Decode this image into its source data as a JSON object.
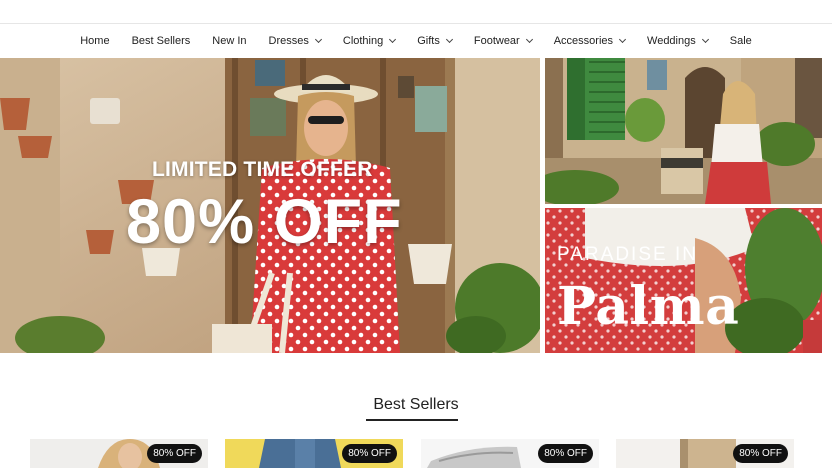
{
  "nav": {
    "items": [
      {
        "label": "Home",
        "dropdown": false
      },
      {
        "label": "Best Sellers",
        "dropdown": false
      },
      {
        "label": "New In",
        "dropdown": false
      },
      {
        "label": "Dresses",
        "dropdown": true
      },
      {
        "label": "Clothing",
        "dropdown": true
      },
      {
        "label": "Gifts",
        "dropdown": true
      },
      {
        "label": "Footwear",
        "dropdown": true
      },
      {
        "label": "Accessories",
        "dropdown": true
      },
      {
        "label": "Weddings",
        "dropdown": true
      },
      {
        "label": "Sale",
        "dropdown": false
      }
    ]
  },
  "hero": {
    "line1": "LIMITED TIME OFFER",
    "line2": "80% OFF"
  },
  "promo_bottom": {
    "line1": "PARADISE IN",
    "line2": "Palma"
  },
  "best_sellers": {
    "title": "Best Sellers",
    "products": [
      {
        "badge": "80% OFF"
      },
      {
        "badge": "80% OFF"
      },
      {
        "badge": "80% OFF"
      },
      {
        "badge": "80% OFF"
      }
    ]
  },
  "colors": {
    "dress_red": "#d93a3a",
    "wall_tan": "#c9ac88",
    "door_wood": "#8a6440",
    "shutter_green": "#3f8a3f",
    "badge_black": "#111111"
  }
}
